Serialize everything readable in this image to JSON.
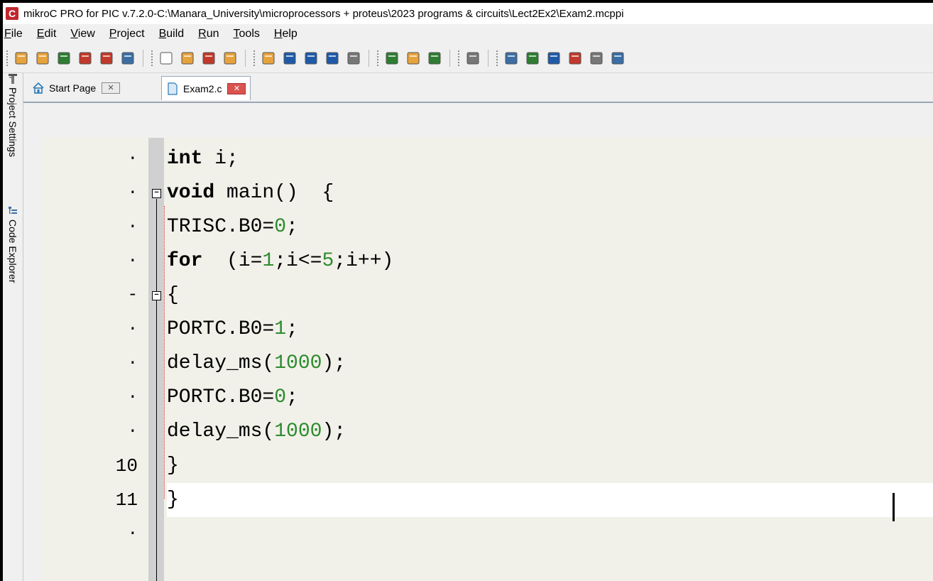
{
  "window": {
    "title": "mikroC PRO for PIC v.7.2.0-C:\\Manara_University\\microprocessors + proteus\\2023 programs & circuits\\Lect2Ex2\\Exam2.mcppi",
    "app_icon_letter": "C"
  },
  "menu": {
    "items": [
      {
        "key": "F",
        "rest": "ile"
      },
      {
        "key": "E",
        "rest": "dit"
      },
      {
        "key": "V",
        "rest": "iew"
      },
      {
        "key": "P",
        "rest": "roject"
      },
      {
        "key": "B",
        "rest": "uild"
      },
      {
        "key": "R",
        "rest": "un"
      },
      {
        "key": "T",
        "rest": "ools"
      },
      {
        "key": "H",
        "rest": "elp"
      }
    ]
  },
  "toolbar": {
    "icons": [
      "new-project-icon",
      "open-project-dropdown-icon",
      "save-project-icon",
      "edit-project-icon",
      "close-project-icon",
      "project-manager-icon",
      "new-file-icon",
      "add-file-icon",
      "remove-file-icon",
      "file-properties-icon",
      "open-file-dropdown-icon",
      "save-file-icon",
      "save-all-icon",
      "print-preview-icon",
      "print-icon",
      "build-icon",
      "build-all-icon",
      "build-program-icon",
      "program-chip-icon",
      "terminal-icon",
      "gprs-icon",
      "ascii-chart-icon",
      "export-icon",
      "options-icon",
      "tools-icon"
    ]
  },
  "dock": {
    "project_settings_label": "Project Settings",
    "code_explorer_label": "Code Explorer"
  },
  "tabs": {
    "start_page": "Start Page",
    "file": "Exam2.c",
    "close_glyph": "✕"
  },
  "editor": {
    "line_numbers": [
      "·",
      "·",
      "·",
      "·",
      "-",
      "·",
      "·",
      "·",
      "·",
      "10",
      "11",
      "·"
    ],
    "lines": [
      [
        {
          "t": "int",
          "c": "kw"
        },
        {
          "t": " i;",
          "c": ""
        }
      ],
      [
        {
          "t": "void",
          "c": "kw"
        },
        {
          "t": " main()  {",
          "c": ""
        }
      ],
      [
        {
          "t": "TRISC.B0=",
          "c": ""
        },
        {
          "t": "0",
          "c": "num"
        },
        {
          "t": ";",
          "c": ""
        }
      ],
      [
        {
          "t": "for",
          "c": "kw"
        },
        {
          "t": "  (i=",
          "c": ""
        },
        {
          "t": "1",
          "c": "num"
        },
        {
          "t": ";i<=",
          "c": ""
        },
        {
          "t": "5",
          "c": "num"
        },
        {
          "t": ";i++)",
          "c": ""
        }
      ],
      [
        {
          "t": "{",
          "c": ""
        }
      ],
      [
        {
          "t": "PORTC.B0=",
          "c": ""
        },
        {
          "t": "1",
          "c": "num"
        },
        {
          "t": ";",
          "c": ""
        }
      ],
      [
        {
          "t": "delay_ms(",
          "c": ""
        },
        {
          "t": "1000",
          "c": "num"
        },
        {
          "t": ");",
          "c": ""
        }
      ],
      [
        {
          "t": "PORTC.B0=",
          "c": ""
        },
        {
          "t": "0",
          "c": "num"
        },
        {
          "t": ";",
          "c": ""
        }
      ],
      [
        {
          "t": "delay_ms(",
          "c": ""
        },
        {
          "t": "1000",
          "c": "num"
        },
        {
          "t": ");",
          "c": ""
        }
      ],
      [
        {
          "t": "}",
          "c": ""
        }
      ],
      [
        {
          "t": "}",
          "c": ""
        }
      ],
      []
    ],
    "current_line": 10,
    "colors": {
      "keyword": "#000000",
      "number": "#2e8b2e",
      "background": "#f1f1ea",
      "current_line": "#ffffff"
    }
  }
}
